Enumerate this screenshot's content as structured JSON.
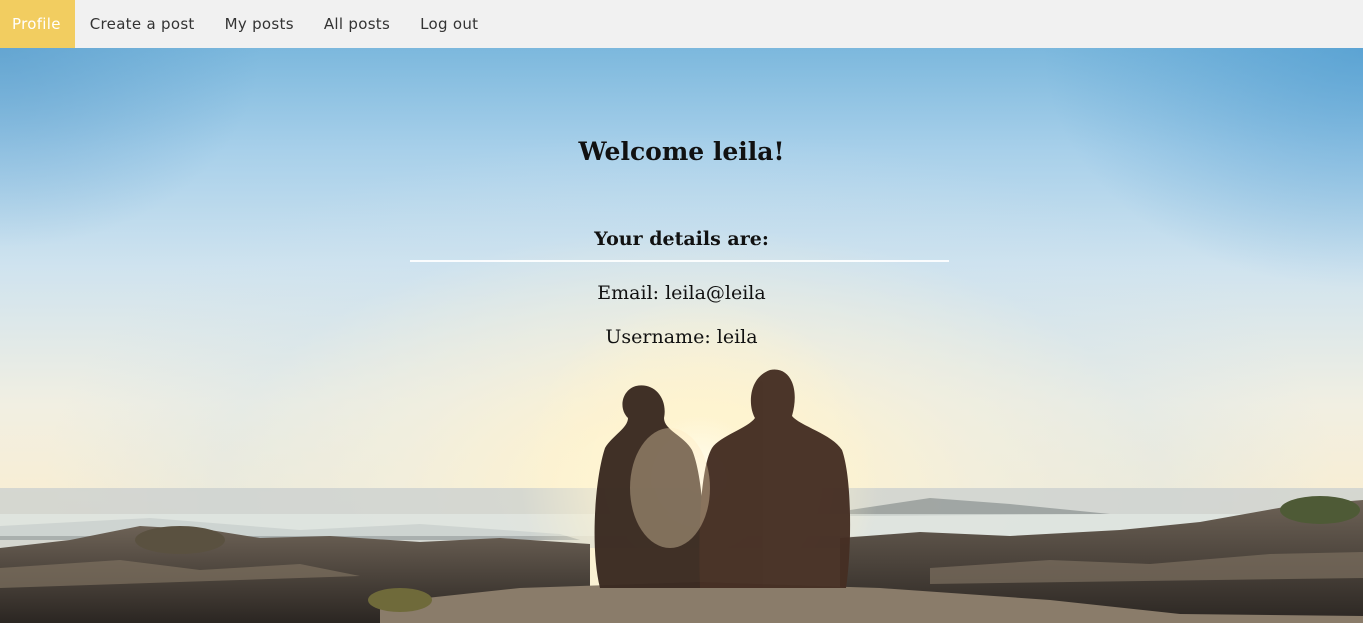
{
  "nav": {
    "items": [
      {
        "label": "Profile",
        "active": true
      },
      {
        "label": "Create a post",
        "active": false
      },
      {
        "label": "My posts",
        "active": false
      },
      {
        "label": "All posts",
        "active": false
      },
      {
        "label": "Log out",
        "active": false
      }
    ]
  },
  "profile": {
    "welcome": "Welcome leila!",
    "details_heading": "Your details are:",
    "email_line": "Email: leila@leila",
    "username_line": "Username: leila"
  },
  "colors": {
    "nav_background": "#f1f1f1",
    "active_nav": "#f2cd60",
    "text": "#111111"
  }
}
